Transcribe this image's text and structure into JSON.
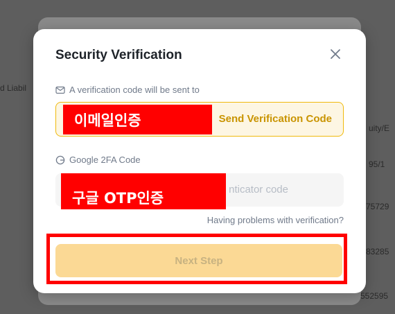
{
  "background": {
    "left_text": "d Liabil",
    "right_texts": [
      "uity/E",
      "95/1",
      "75729",
      "83285",
      "552595"
    ]
  },
  "modal": {
    "title": "Security Verification",
    "email_label": "A verification code will be sent to",
    "email_redaction_text": "이메일인증",
    "send_code_label": "Send Verification Code",
    "google_label": "Google 2FA Code",
    "google_placeholder_visible": "nticator code",
    "google_redaction_text": "구글 OTP인증",
    "problems_link": "Having problems with verification?",
    "next_button": "Next Step"
  },
  "colors": {
    "accent": "#f0b90b",
    "accent_text": "#c99400",
    "button_disabled_bg": "#fbd995",
    "redaction": "#ff0000"
  },
  "icons": {
    "close": "close-icon",
    "email": "mail-icon",
    "google": "google-icon"
  }
}
